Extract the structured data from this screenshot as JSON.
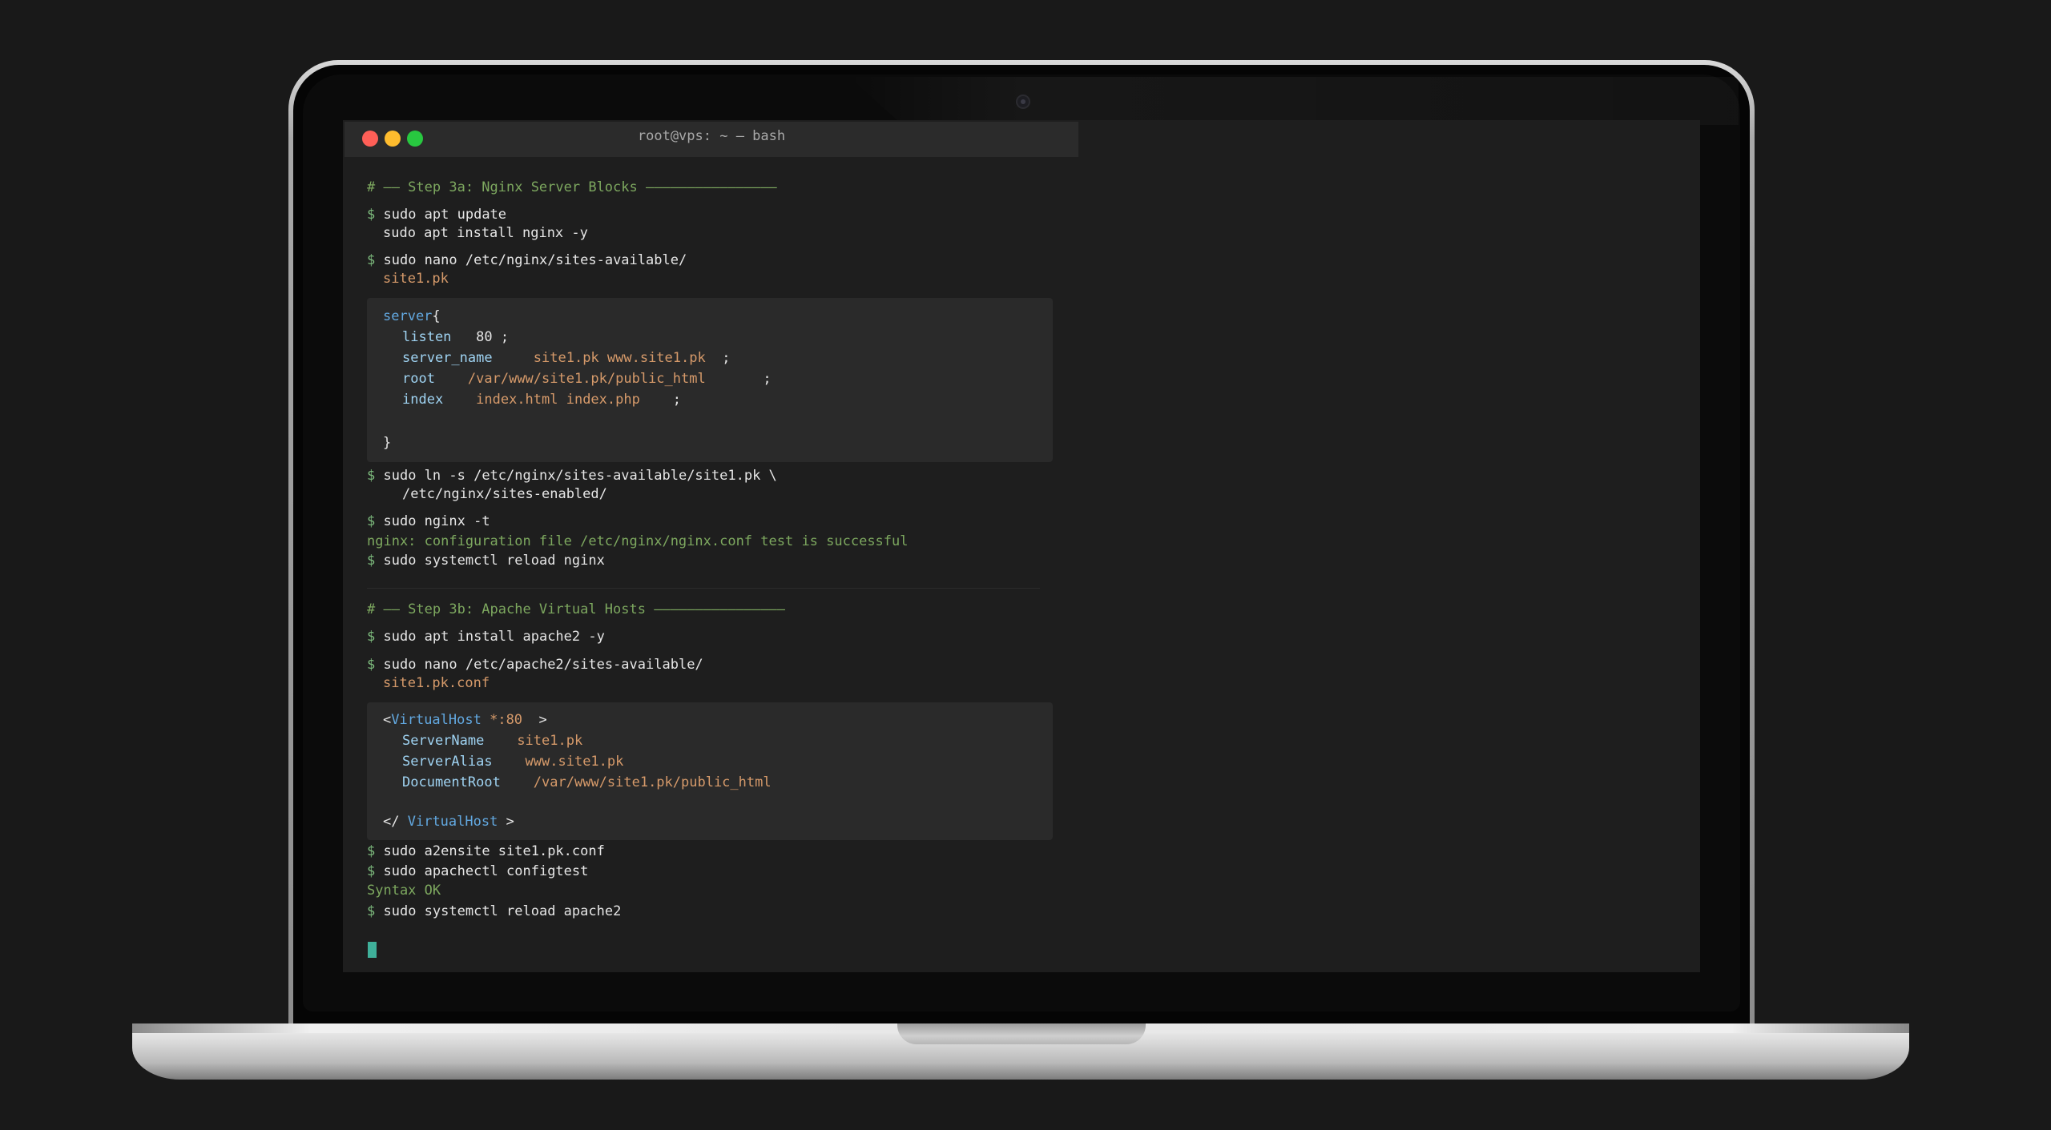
{
  "window": {
    "title": "root@vps: ~ — bash",
    "traffic_lights": [
      "close-dot",
      "minimize-dot",
      "zoom-dot"
    ]
  },
  "colors": {
    "comment": "#7da85f",
    "prompt": "#7dbb7d",
    "string": "#d69a6a",
    "keyword": "#62a8e0",
    "directive": "#9fd3f2",
    "cursor": "#3fb09a"
  },
  "nginx": {
    "heading": "# —— Step 3a: Nginx Server Blocks ————————————————",
    "prompt": "$",
    "cmd_update": "sudo apt update",
    "cmd_install": "sudo apt install nginx -y",
    "cmd_nano": "sudo nano /etc/nginx/sites-available/",
    "file": "site1.pk",
    "config": {
      "server": "server",
      "open_brace": "{",
      "listen_key": "listen",
      "listen_val": "80",
      "server_name_key": "server_name",
      "server_name_val": "site1.pk www.site1.pk",
      "root_key": "root",
      "root_val": "/var/www/site1.pk/public_html",
      "index_key": "index",
      "index_val": "index.html index.php",
      "semicolon": ";",
      "close_brace": "}"
    },
    "cmd_ln_1": "sudo ln -s /etc/nginx/sites-available/site1.pk \\",
    "cmd_ln_2": "/etc/nginx/sites-enabled/",
    "cmd_test": "sudo nginx -t",
    "test_output": "nginx: configuration file /etc/nginx/nginx.conf test is successful",
    "cmd_reload": "sudo systemctl reload nginx"
  },
  "apache": {
    "heading": "# —— Step 3b: Apache Virtual Hosts ————————————————",
    "cmd_install": "sudo apt install apache2 -y",
    "cmd_nano": "sudo nano /etc/apache2/sites-available/",
    "file": "site1.pk.conf",
    "config": {
      "lt": "<",
      "vhost": "VirtualHost",
      "port": "*:80",
      "gt": ">",
      "servername_key": "ServerName",
      "servername_val": "site1.pk",
      "serveralias_key": "ServerAlias",
      "serveralias_val": "www.site1.pk",
      "docroot_key": "DocumentRoot",
      "docroot_val": "/var/www/site1.pk/public_html",
      "close_lt": "</"
    },
    "cmd_ensite": "sudo a2ensite site1.pk.conf",
    "cmd_configtest": "sudo apachectl configtest",
    "configtest_output": "Syntax OK",
    "cmd_reload": "sudo systemctl reload apache2"
  }
}
